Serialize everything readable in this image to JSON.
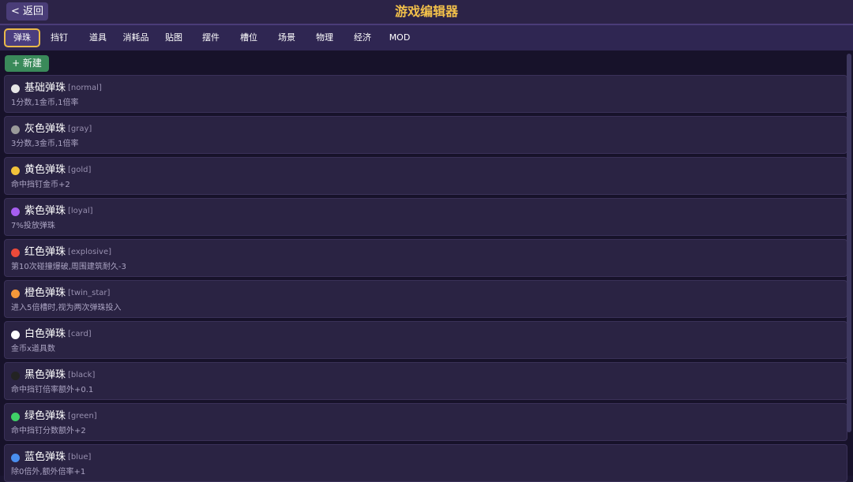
{
  "header": {
    "back_label": "< 返回",
    "title": "游戏编辑器"
  },
  "tabs": [
    "弹珠",
    "挡钉",
    "道具",
    "消耗品",
    "贴图",
    "摆件",
    "槽位",
    "场景",
    "物理",
    "经济",
    "MOD"
  ],
  "active_tab": "弹珠",
  "toolbar": {
    "new_label": "+ 新建"
  },
  "items": [
    {
      "name": "基础弹珠",
      "id": "[normal]",
      "desc": "1分数,1金币,1倍率",
      "color": "#e6e6e6"
    },
    {
      "name": "灰色弹珠",
      "id": "[gray]",
      "desc": "3分数,3金币,1倍率",
      "color": "#9a9a9a"
    },
    {
      "name": "黄色弹珠",
      "id": "[gold]",
      "desc": "命中挡钉金币+2",
      "color": "#f2c23a"
    },
    {
      "name": "紫色弹珠",
      "id": "[loyal]",
      "desc": "7%投放弹珠",
      "color": "#a65ef0"
    },
    {
      "name": "红色弹珠",
      "id": "[explosive]",
      "desc": "第10次碰撞爆破,周围建筑耐久-3",
      "color": "#ec4a3a"
    },
    {
      "name": "橙色弹珠",
      "id": "[twin_star]",
      "desc": "进入5倍槽时,视为两次弹珠投入",
      "color": "#f5983a"
    },
    {
      "name": "白色弹珠",
      "id": "[card]",
      "desc": "金币x道具数",
      "color": "#ffffff"
    },
    {
      "name": "黑色弹珠",
      "id": "[black]",
      "desc": "命中挡钉倍率额外+0.1",
      "color": "#232323"
    },
    {
      "name": "绿色弹珠",
      "id": "[green]",
      "desc": "命中挡钉分数额外+2",
      "color": "#3fd067"
    },
    {
      "name": "蓝色弹珠",
      "id": "[blue]",
      "desc": "除0倍外,额外倍率+1",
      "color": "#4a8ff0"
    }
  ]
}
